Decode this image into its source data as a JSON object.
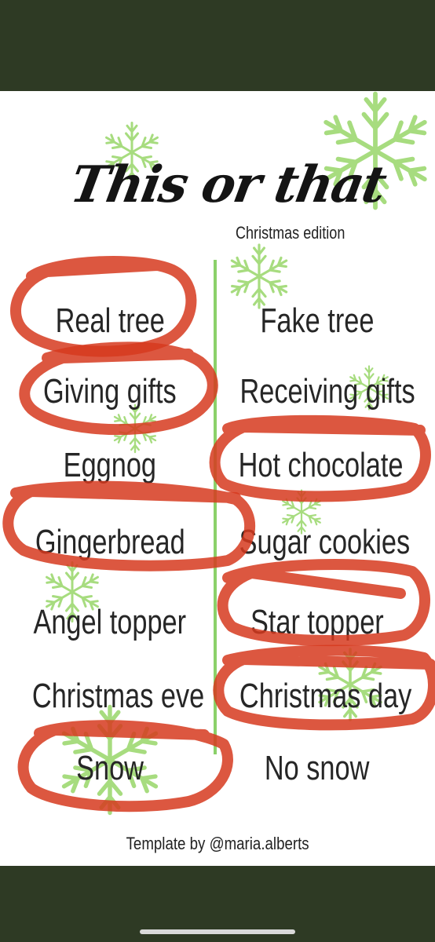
{
  "title": "This or that",
  "subtitle": "Christmas edition",
  "rows": [
    {
      "left": "Real tree",
      "right": "Fake tree"
    },
    {
      "left": "Giving gifts",
      "right": "Receiving gifts"
    },
    {
      "left": "Eggnog",
      "right": "Hot chocolate"
    },
    {
      "left": "Gingerbread",
      "right": "Sugar cookies"
    },
    {
      "left": "Angel topper",
      "right": "Star topper"
    },
    {
      "left": "Christmas eve",
      "right": "Christmas day"
    },
    {
      "left": "Snow",
      "right": "No snow"
    }
  ],
  "footer": "Template by @maria.alberts",
  "colors": {
    "frame": "#2e3a24",
    "background": "#ffffff",
    "snowflake": "#a7dc7f",
    "divider": "#8bd16a",
    "circle_marker": "#d63a1f"
  },
  "icons": [
    "snowflake-icon"
  ]
}
